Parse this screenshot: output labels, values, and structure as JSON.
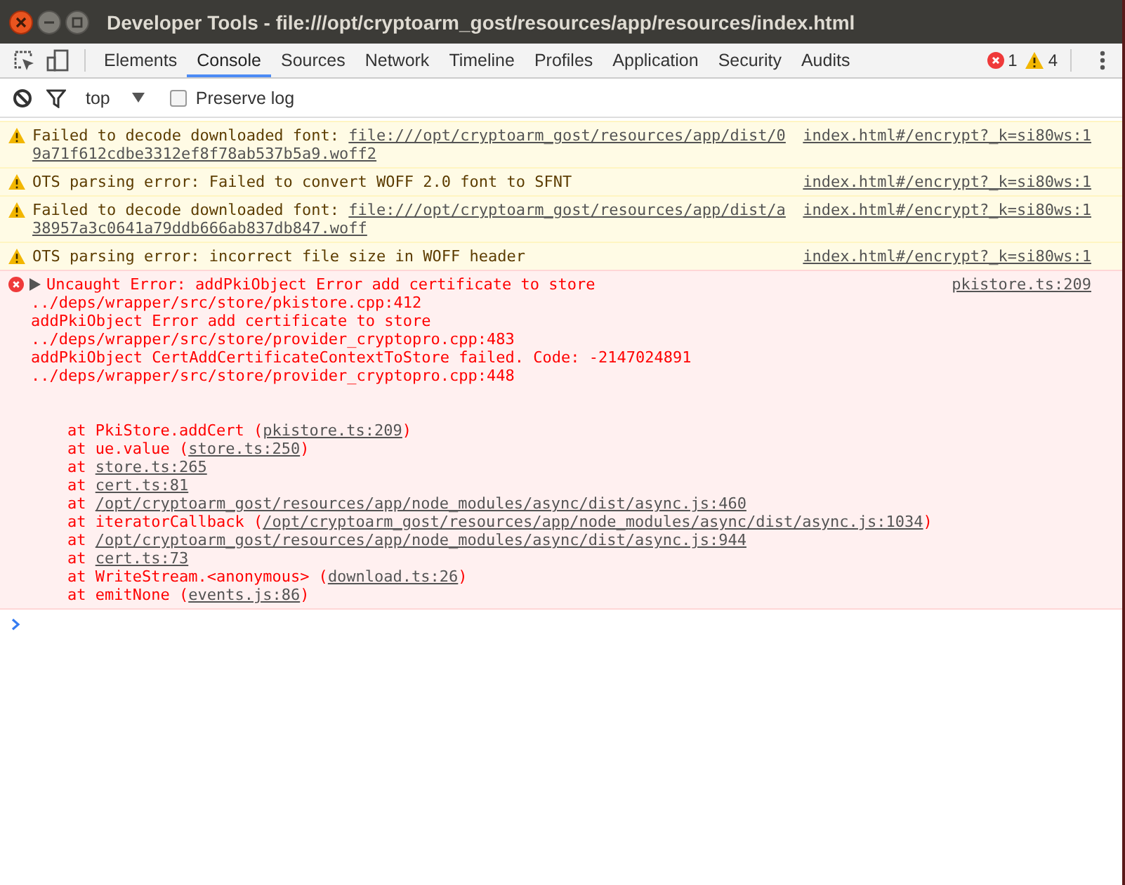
{
  "window": {
    "title": "Developer Tools - file:///opt/cryptoarm_gost/resources/app/resources/index.html"
  },
  "tabs": [
    {
      "label": "Elements",
      "selected": false
    },
    {
      "label": "Console",
      "selected": true
    },
    {
      "label": "Sources",
      "selected": false
    },
    {
      "label": "Network",
      "selected": false
    },
    {
      "label": "Timeline",
      "selected": false
    },
    {
      "label": "Profiles",
      "selected": false
    },
    {
      "label": "Application",
      "selected": false
    },
    {
      "label": "Security",
      "selected": false
    },
    {
      "label": "Audits",
      "selected": false
    }
  ],
  "counters": {
    "errors": "1",
    "warnings": "4"
  },
  "console_toolbar": {
    "context": "top",
    "preserve_log": {
      "label": "Preserve log",
      "checked": false
    }
  },
  "messages": [
    {
      "kind": "warning",
      "source": "index.html#/encrypt?_k=si80ws:1",
      "lines": [
        [
          {
            "text": "Failed to decode downloaded font: ",
            "kind": "plain"
          },
          {
            "text": "file:///opt/cryptoarm_gost/resources/app/dist/0",
            "kind": "link"
          }
        ],
        [
          {
            "text": "9a71f612cdbe3312ef8f78ab537b5a9.woff2",
            "kind": "link"
          }
        ]
      ]
    },
    {
      "kind": "warning",
      "source": "index.html#/encrypt?_k=si80ws:1",
      "lines": [
        [
          {
            "text": "OTS parsing error: Failed to convert WOFF 2.0 font to SFNT",
            "kind": "plain"
          }
        ]
      ]
    },
    {
      "kind": "warning",
      "source": "index.html#/encrypt?_k=si80ws:1",
      "lines": [
        [
          {
            "text": "Failed to decode downloaded font: ",
            "kind": "plain"
          },
          {
            "text": "file:///opt/cryptoarm_gost/resources/app/dist/a",
            "kind": "link"
          }
        ],
        [
          {
            "text": "38957a3c0641a79ddb666ab837db847.woff",
            "kind": "link"
          }
        ]
      ]
    },
    {
      "kind": "warning",
      "source": "index.html#/encrypt?_k=si80ws:1",
      "lines": [
        [
          {
            "text": "OTS parsing error: incorrect file size in WOFF header",
            "kind": "plain"
          }
        ]
      ]
    },
    {
      "kind": "error",
      "source": "pkistore.ts:209",
      "lines": [
        [
          {
            "text": "Uncaught Error: addPkiObject Error add certificate to store",
            "kind": "plain"
          }
        ],
        [
          {
            "text": "../deps/wrapper/src/store/pkistore.cpp:412",
            "kind": "plain"
          }
        ],
        [
          {
            "text": "addPkiObject Error add certificate to store",
            "kind": "plain"
          }
        ],
        [
          {
            "text": "../deps/wrapper/src/store/provider_cryptopro.cpp:483",
            "kind": "plain"
          }
        ],
        [
          {
            "text": "addPkiObject CertAddCertificateContextToStore failed. Code: -2147024891",
            "kind": "plain"
          }
        ],
        [
          {
            "text": "../deps/wrapper/src/store/provider_cryptopro.cpp:448",
            "kind": "plain"
          }
        ]
      ],
      "stack": [
        [
          {
            "text": "at PkiStore.addCert (",
            "kind": "plain"
          },
          {
            "text": "pkistore.ts:209",
            "kind": "link"
          },
          {
            "text": ")",
            "kind": "plain"
          }
        ],
        [
          {
            "text": "at ue.value (",
            "kind": "plain"
          },
          {
            "text": "store.ts:250",
            "kind": "link"
          },
          {
            "text": ")",
            "kind": "plain"
          }
        ],
        [
          {
            "text": "at ",
            "kind": "plain"
          },
          {
            "text": "store.ts:265",
            "kind": "link"
          }
        ],
        [
          {
            "text": "at ",
            "kind": "plain"
          },
          {
            "text": "cert.ts:81",
            "kind": "link"
          }
        ],
        [
          {
            "text": "at ",
            "kind": "plain"
          },
          {
            "text": "/opt/cryptoarm_gost/resources/app/node_modules/async/dist/async.js:460",
            "kind": "link"
          }
        ],
        [
          {
            "text": "at iteratorCallback (",
            "kind": "plain"
          },
          {
            "text": "/opt/cryptoarm_gost/resources/app/node_modules/async/dist/async.js:1034",
            "kind": "link"
          },
          {
            "text": ")",
            "kind": "plain"
          }
        ],
        [
          {
            "text": "at ",
            "kind": "plain"
          },
          {
            "text": "/opt/cryptoarm_gost/resources/app/node_modules/async/dist/async.js:944",
            "kind": "link"
          }
        ],
        [
          {
            "text": "at ",
            "kind": "plain"
          },
          {
            "text": "cert.ts:73",
            "kind": "link"
          }
        ],
        [
          {
            "text": "at WriteStream.<anonymous> (",
            "kind": "plain"
          },
          {
            "text": "download.ts:26",
            "kind": "link"
          },
          {
            "text": ")",
            "kind": "plain"
          }
        ],
        [
          {
            "text": "at emitNone (",
            "kind": "plain"
          },
          {
            "text": "events.js:86",
            "kind": "link"
          },
          {
            "text": ")",
            "kind": "plain"
          }
        ]
      ]
    }
  ]
}
